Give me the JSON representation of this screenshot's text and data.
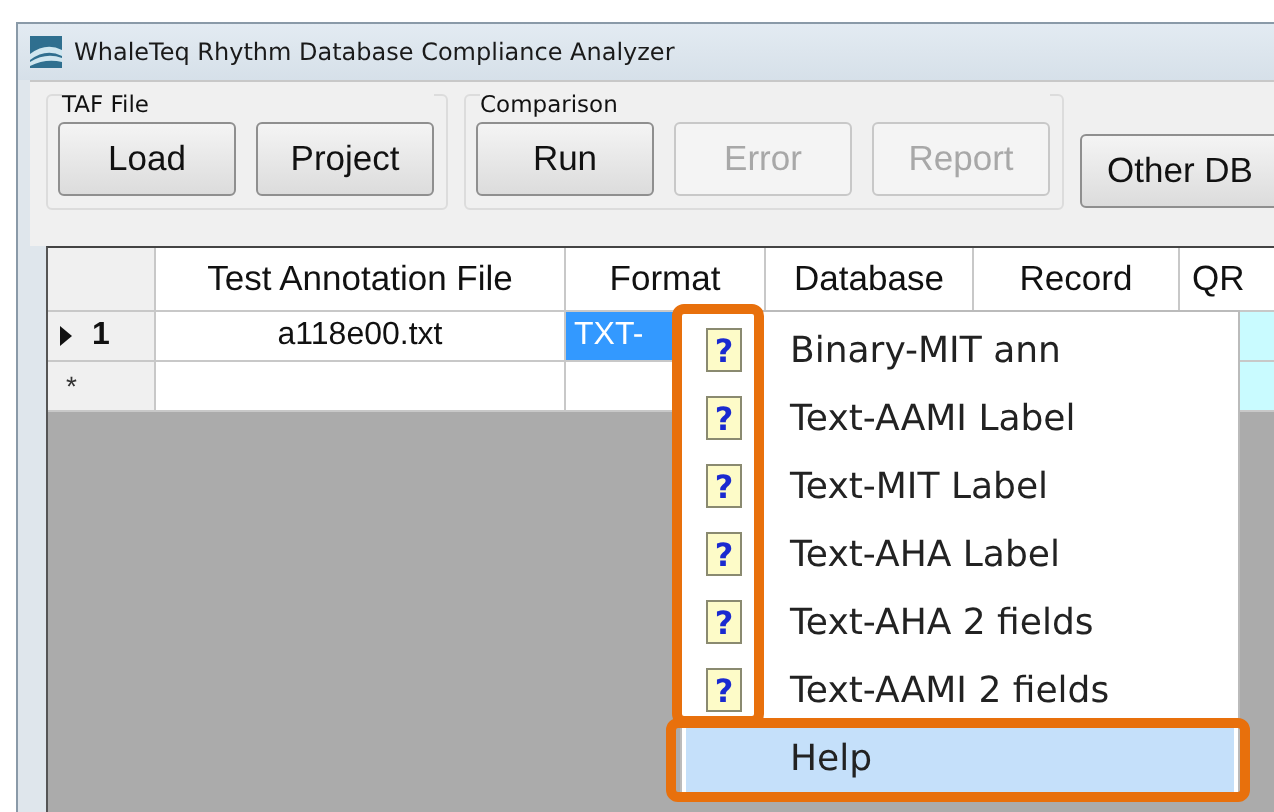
{
  "window": {
    "title": "WhaleTeq Rhythm Database Compliance Analyzer"
  },
  "toolbar": {
    "groups": [
      {
        "label": "TAF File",
        "buttons": [
          {
            "label": "Load",
            "disabled": false
          },
          {
            "label": "Project",
            "disabled": false
          }
        ]
      },
      {
        "label": "Comparison",
        "buttons": [
          {
            "label": "Run",
            "disabled": false
          },
          {
            "label": "Error",
            "disabled": true
          },
          {
            "label": "Report",
            "disabled": true
          }
        ]
      }
    ],
    "extra_buttons": [
      {
        "label": "Other DB",
        "disabled": false
      }
    ]
  },
  "grid": {
    "columns": [
      "Test Annotation File",
      "Format",
      "Database",
      "Record",
      "QR"
    ],
    "rows": [
      {
        "header": "1",
        "current": true,
        "cells": [
          {
            "text": "a118e00.txt",
            "selected": false
          },
          {
            "text": "TXT-",
            "selected": true
          },
          {},
          {},
          {
            "selected": false
          }
        ]
      },
      {
        "header": "*",
        "current": false,
        "cells": [
          {
            "selected": false
          },
          {
            "selected": false
          },
          {},
          {},
          {
            "selected": false
          }
        ]
      }
    ]
  },
  "context_menu": {
    "items": [
      {
        "icon": "?",
        "label": "Binary-MIT ann",
        "selected": false
      },
      {
        "icon": "?",
        "label": "Text-AAMI Label",
        "selected": false
      },
      {
        "icon": "?",
        "label": "Text-MIT Label",
        "selected": false
      },
      {
        "icon": "?",
        "label": "Text-AHA Label",
        "selected": false
      },
      {
        "icon": "?",
        "label": "Text-AHA 2 fields",
        "selected": false
      },
      {
        "icon": "?",
        "label": "Text-AAMI 2 fields",
        "selected": false
      },
      {
        "label": "Help",
        "selected": true
      }
    ]
  }
}
